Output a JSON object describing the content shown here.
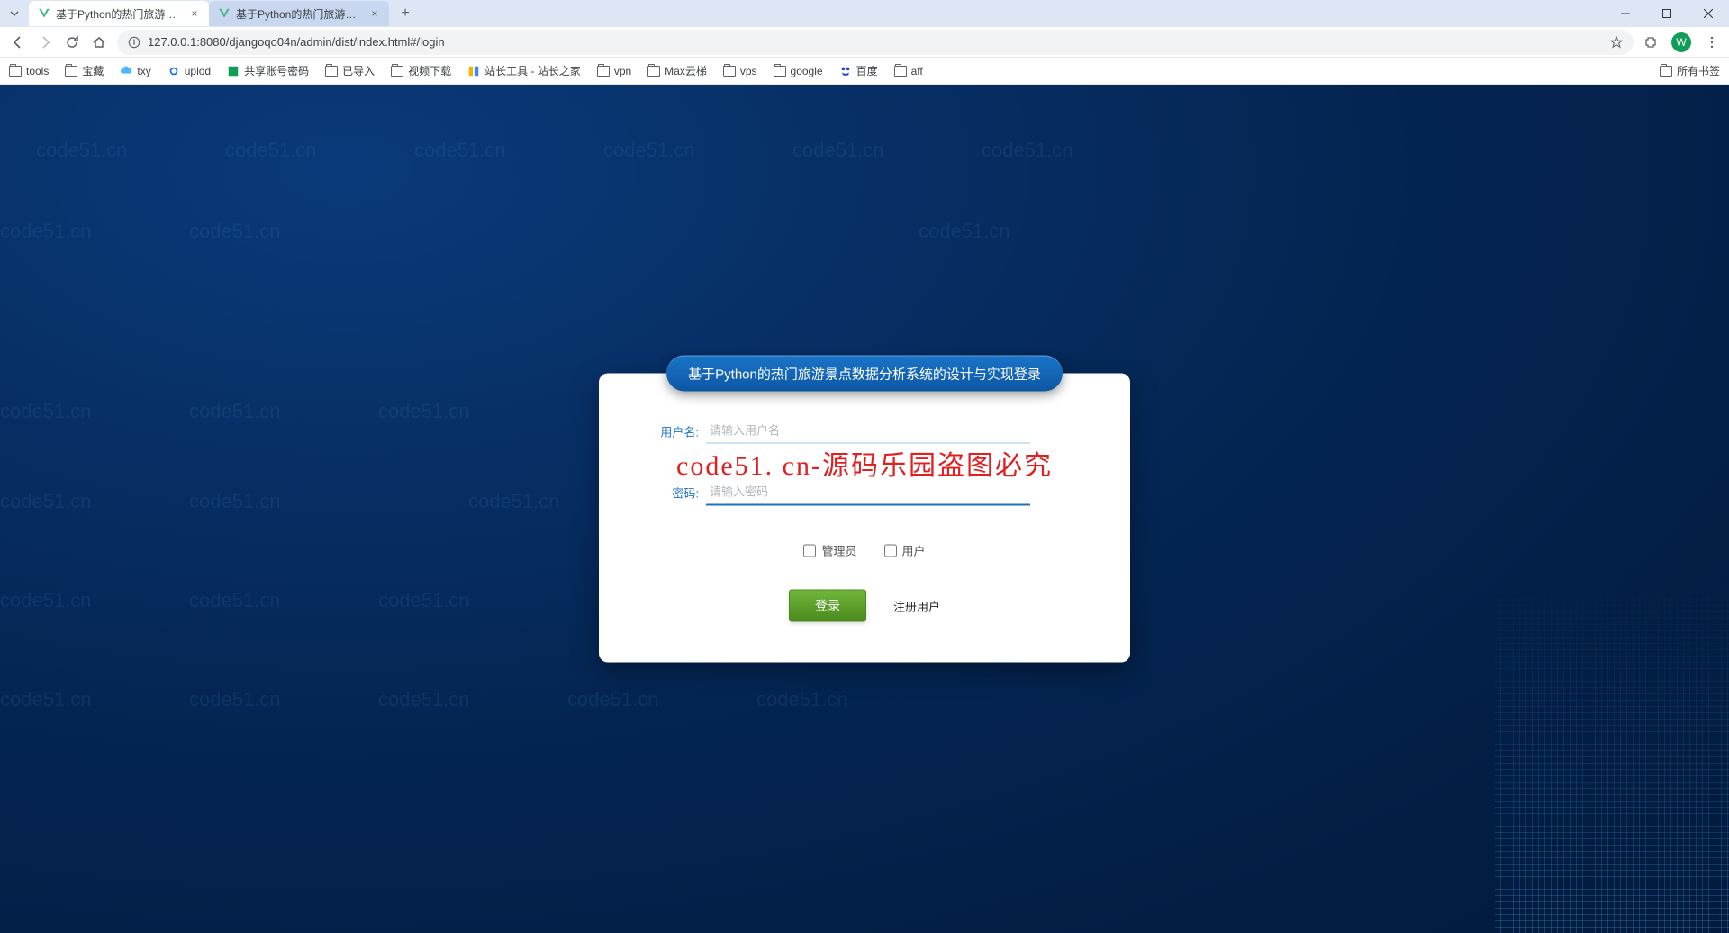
{
  "browser": {
    "tabs": [
      {
        "title": "基于Python的热门旅游景点数…",
        "active": true
      },
      {
        "title": "基于Python的热门旅游景点数…",
        "active": false
      }
    ],
    "url": "127.0.0.1:8080/djangoqo04n/admin/dist/index.html#/login",
    "avatar_letter": "W",
    "bookmarks": [
      "tools",
      "宝藏",
      "txy",
      "uplod",
      "共享账号密码",
      "已导入",
      "视频下载",
      "站长工具 - 站长之家",
      "vpn",
      "Max云梯",
      "vps",
      "google",
      "百度",
      "aff"
    ],
    "all_bookmarks": "所有书签"
  },
  "login": {
    "header": "基于Python的热门旅游景点数据分析系统的设计与实现登录",
    "username_label": "用户名:",
    "username_placeholder": "请输入用户名",
    "password_label": "密码:",
    "password_placeholder": "请输入密码",
    "role_admin": "管理员",
    "role_user": "用户",
    "login_btn": "登录",
    "register_link": "注册用户"
  },
  "watermark": "code51. cn-源码乐园盗图必究",
  "wm_text": "code51.cn"
}
